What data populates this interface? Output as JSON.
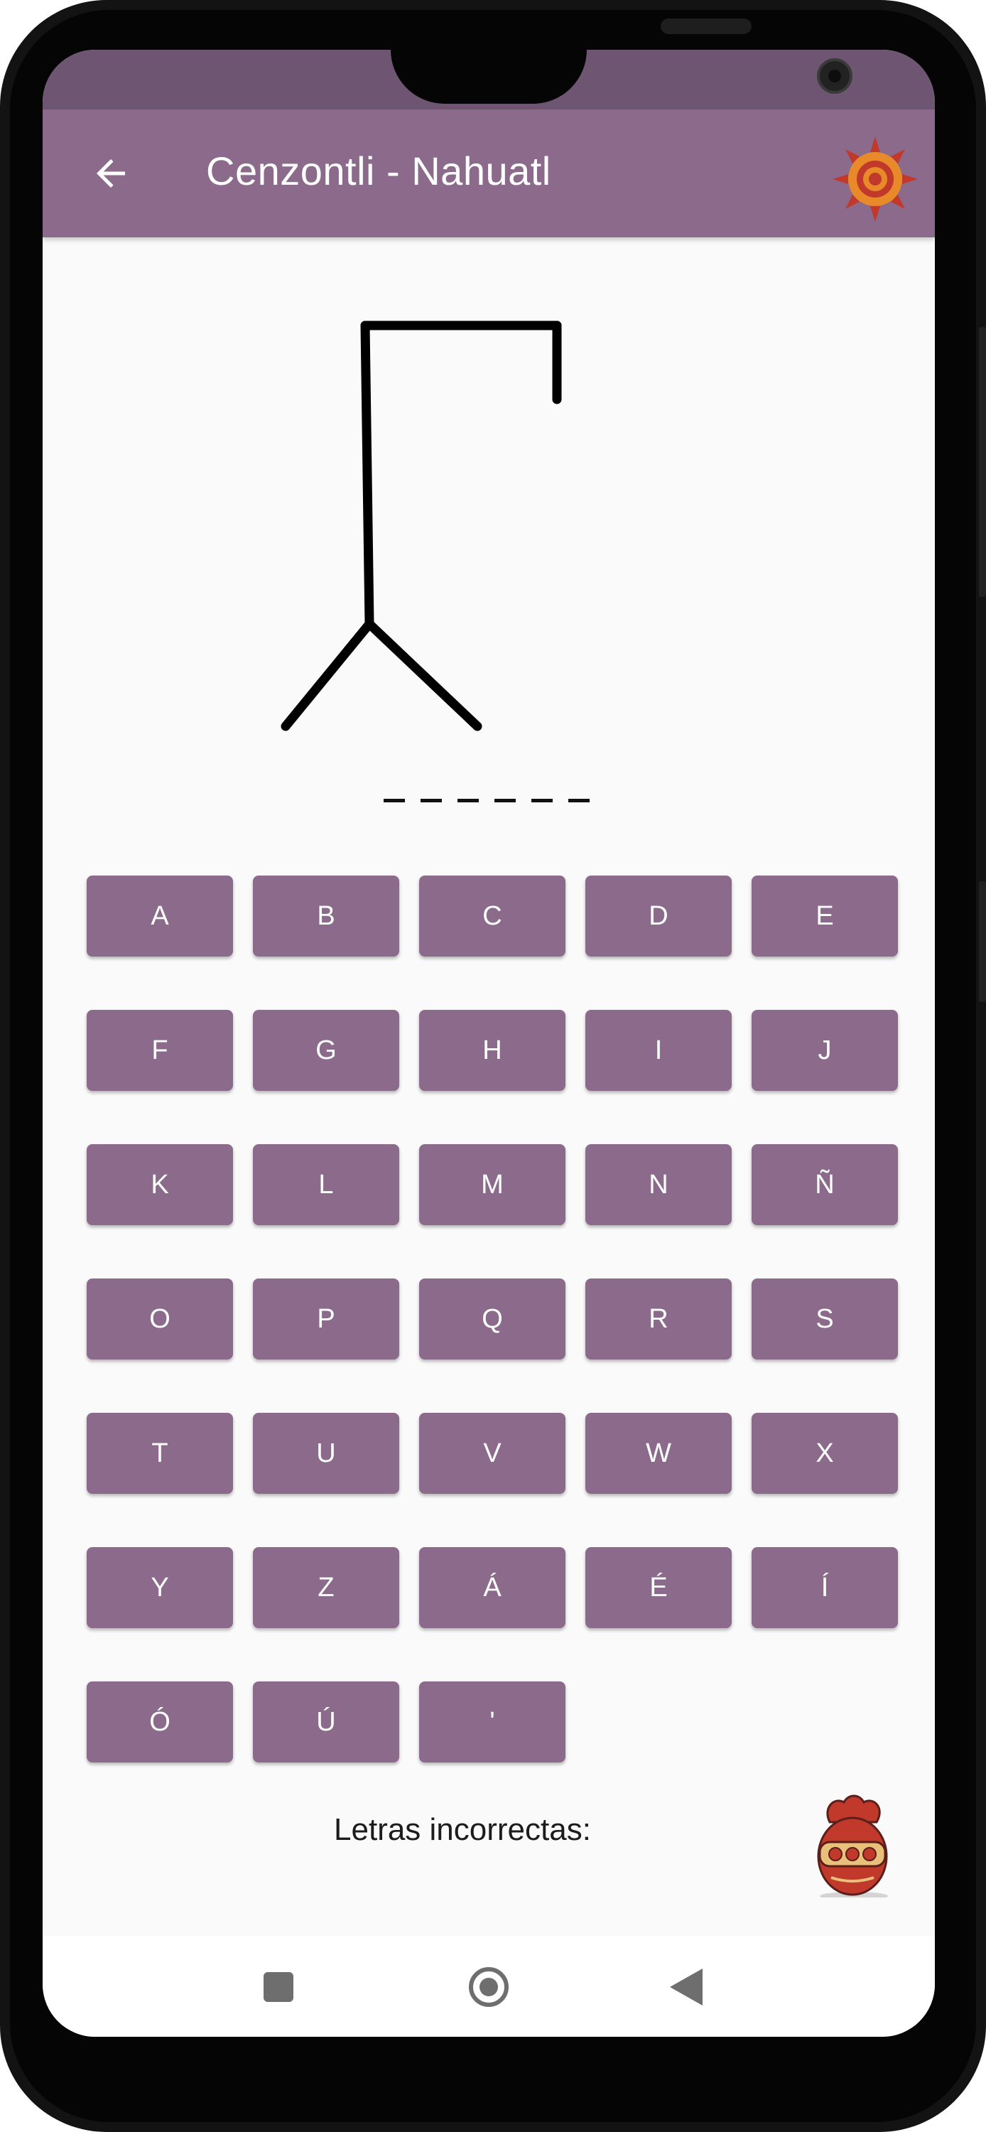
{
  "app_bar": {
    "title": "Cenzontli - Nahuatl",
    "back_icon": "arrow-left-icon",
    "logo_icon": "sun-emblem-icon"
  },
  "game": {
    "word_length": 6,
    "wrong_label": "Letras incorrectas:",
    "wrong_letters": ""
  },
  "keyboard": {
    "rows": [
      [
        "A",
        "B",
        "C",
        "D",
        "E"
      ],
      [
        "F",
        "G",
        "H",
        "I",
        "J"
      ],
      [
        "K",
        "L",
        "M",
        "N",
        "Ñ"
      ],
      [
        "O",
        "P",
        "Q",
        "R",
        "S"
      ],
      [
        "T",
        "U",
        "V",
        "W",
        "X"
      ],
      [
        "Y",
        "Z",
        "Á",
        "É",
        "Í"
      ],
      [
        "Ó",
        "Ú",
        "'"
      ]
    ]
  },
  "mascot": {
    "icon": "clay-figure-icon"
  },
  "navigation": {
    "recents_icon": "square-icon",
    "home_icon": "circle-icon",
    "back_icon": "triangle-back-icon"
  },
  "colors": {
    "primary": "#8c6a8c",
    "status_bar": "#6e5572",
    "background": "#fafafa",
    "logo_orange": "#e88a2a",
    "logo_red": "#c0392b"
  }
}
